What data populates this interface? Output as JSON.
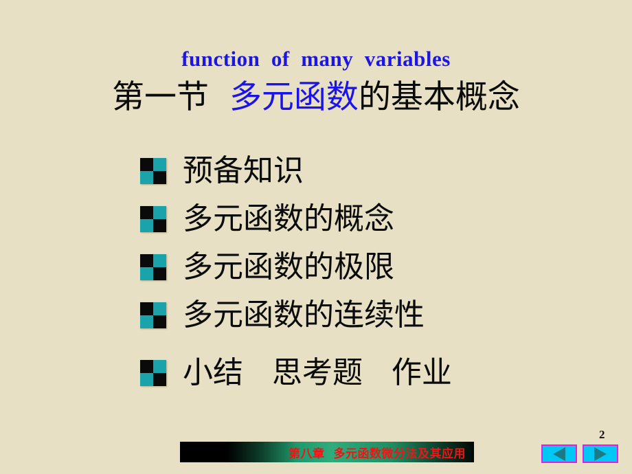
{
  "slide": {
    "background_color": "#e7e0c4",
    "title_en": "function  of  many  variables",
    "title_en_color": "#1c16e0",
    "title_cn_prefix": "第一节  ",
    "title_cn_highlight": "多元函数",
    "title_cn_suffix": "的基本概念",
    "title_cn_highlight_color": "#1b14e8",
    "title_cn_color": "#0a0a0a"
  },
  "bullets": {
    "marker_colors": {
      "dark": "#0a0a0a",
      "teal": "#1aa3ab"
    },
    "items": [
      {
        "label": "预备知识"
      },
      {
        "label": "多元函数的概念"
      },
      {
        "label": "多元函数的极限"
      },
      {
        "label": "多元函数的连续性"
      },
      {
        "label": "小结   思考题   作业"
      }
    ]
  },
  "footer": {
    "chapter_text": "第八章  多元函数微分法及其应用",
    "chapter_text_color": "#f01414",
    "bar_gradient_from": "#000000",
    "bar_gradient_to": "#2fab7c",
    "page_number": "2"
  },
  "navigation": {
    "prev_label": "◀",
    "next_label": "▶",
    "button_fill": "#00c8f4",
    "button_border": "#e020e0",
    "arrow_color": "#1b7a85"
  }
}
